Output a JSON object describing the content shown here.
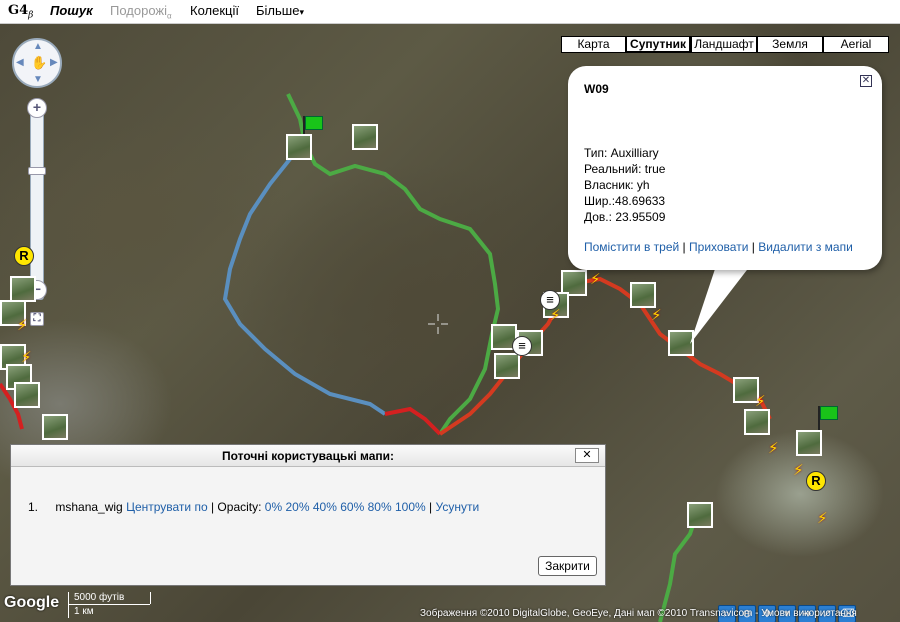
{
  "menu": {
    "logo": "G4",
    "logo_sub": "β",
    "search": "Пошук",
    "trips": "Подорожі",
    "trips_sub": "α",
    "collections": "Колекції",
    "more": "Більше",
    "more_icon": "dropdown-arrow"
  },
  "map_types": [
    "Карта",
    "Супутник",
    "Ландшафт",
    "Земля",
    "Aerial"
  ],
  "map_type_active": "Супутник",
  "zoom": {
    "plus": "+",
    "minus": "−",
    "level": "−",
    "level2": "−"
  },
  "info_window": {
    "title": "W09",
    "close_icon": "close-icon",
    "type": "Тип: Auxilliary",
    "real": "Реальний: true",
    "owner": "Власник: yh",
    "lat": "Шир.:48.69633",
    "lon": "Дов.: 23.95509",
    "links": {
      "add_to_track": "Помістити в трей",
      "hide": "Приховати",
      "remove": "Видалити з мапи",
      "separator": "|"
    }
  },
  "maps_panel": {
    "title": "Поточні користувацькі мапи:",
    "close_x": "✕",
    "rows": [
      {
        "index": "1.",
        "name": "mshana_wig",
        "center": "Центрувати по",
        "opacity_label": "| Opacity:",
        "opacity_options": [
          "0%",
          "20%",
          "40%",
          "60%",
          "80%",
          "100%"
        ],
        "sep": "|",
        "remove": "Усунути"
      }
    ],
    "close_button": "Закрити"
  },
  "map_markers": {
    "r": "R"
  },
  "tools": [
    "magnifier",
    "zoom-out",
    "move",
    "marker",
    "arrow",
    "route",
    "eraser"
  ],
  "scale": {
    "feet": "5000 футів",
    "km": "1 км"
  },
  "google_logo": "Google",
  "copyright": "Зображення ©2010 DigitalGlobe, GeoEye, Дані мап ©2010 Transnavicom - Умови використання",
  "colors": {
    "route_green": "#4caa44",
    "route_blue": "#5a8fbf",
    "route_red": "#d42020",
    "link": "#1f5fa8"
  }
}
